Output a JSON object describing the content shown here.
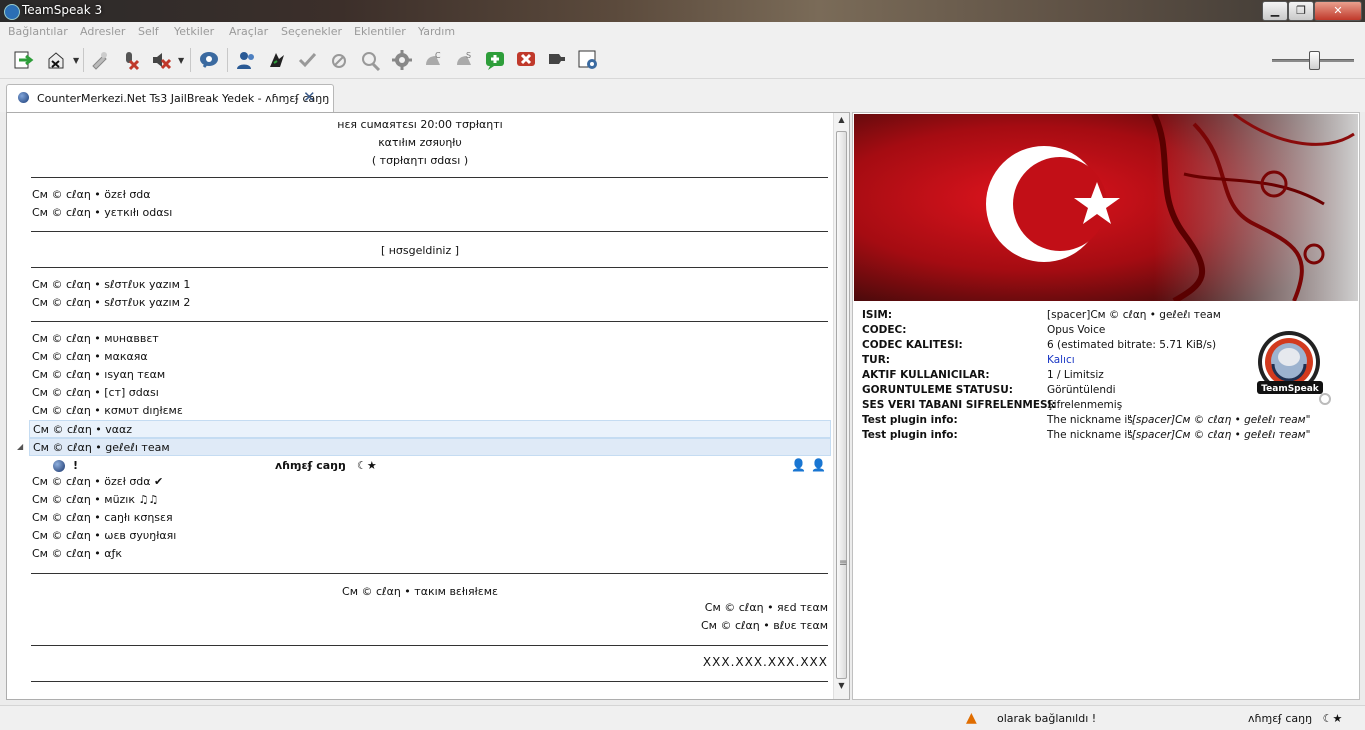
{
  "window": {
    "title": "TeamSpeak 3",
    "min": "▁",
    "max": "❐",
    "close": "✕"
  },
  "menu": [
    "Bağlantılar",
    "Adresler",
    "Self",
    "Yetkiler",
    "Araçlar",
    "Seçenekler",
    "Eklentiler",
    "Yardım"
  ],
  "toolbar": {
    "icons": [
      "connect-icon",
      "disconnect-icon",
      "away-icon",
      "mute-microphone-icon",
      "mute-speakers-icon",
      "whisper-icon",
      "contacts-icon",
      "bookmarks-icon",
      "subscribe-icon",
      "unsubscribe-icon",
      "hotkey-icon",
      "settings-icon",
      "channel-commander-icon",
      "server-query-icon",
      "add-icon",
      "remove-icon",
      "tools-icon",
      "identity-icon"
    ],
    "colors": {
      "accent": "#2b6fb5",
      "danger": "#c0392b",
      "success": "#2e9e3a"
    }
  },
  "tab": {
    "label": "CounterMerkezi.Net Ts3 JailBreak Yedek - ʌɦɱɛʄ caŋŋ",
    "close": "✕"
  },
  "tree": {
    "announce": [
      "нεя cuмαятεsı 20:00 тσpłαηтı",
      "κατıłıм zσяυηłυ",
      "( тσpłαηтı σdαsı )"
    ],
    "group1": [
      "Cм © cℓαη • özεł σdα",
      "Cм © cℓαη • yεткıłı odαsı"
    ],
    "welcome": "[ нσsgeldiniz ]",
    "group2": [
      "Cм © cℓαη • sℓσтℓυк yαzıм 1",
      "Cм © cℓαη • sℓσтℓυк yαzıм 2"
    ],
    "group3": [
      "Cм © cℓαη • мυнαввεт",
      "Cм © cℓαη • мαкαяα",
      "Cм © cℓαη • ısyαη тεαм",
      "Cм © cℓαη • [cт] σdαsı",
      "Cм © cℓαη • кσмυт dıŋłεмε",
      "Cм © cℓαη • vααz",
      "Cм © cℓαη • geℓeℓı тeaм"
    ],
    "client": {
      "prefix": "!",
      "name": "ʌɦɱɛʄ caŋŋ",
      "badge": "☾★"
    },
    "group4": [
      "Cм © cℓαη • özεł σdα ✔",
      "Cм © cℓαη • мüzıк ♫♫",
      "Cм © cℓαη • caŋłı кσηsεя",
      "Cм © cℓαη • ωεв σyυŋłαяı",
      "Cм © cℓαη • αƒк"
    ],
    "teams": {
      "header": "Cм © cℓαη • тαкıм вεłıяłεмε",
      "red": "Cм © cℓαη • яεd тεαм",
      "blue": "Cм © cℓαη • вℓυε тεαм"
    },
    "ip": "XXX.XXX.XXX.XXX"
  },
  "info": {
    "rows": [
      {
        "k": "ISIM:",
        "v": "[spacer]Cм © cℓαη • geℓeℓı тeaм"
      },
      {
        "k": "CODEC:",
        "v": "Opus Voice"
      },
      {
        "k": "CODEC KALITESI:",
        "v": "6 (estimated bitrate: 5.71 KiB/s)"
      },
      {
        "k": "TUR:",
        "v": "Kalıcı"
      },
      {
        "k": "AKTIF KULLANICILAR:",
        "v": "1 / Limitsiz"
      },
      {
        "k": "GORUNTULEME STATUSU:",
        "v": "Görüntülendi"
      },
      {
        "k": "SES VERI TABANI SIFRELENMESI:",
        "v": "Şifrelenmemiş"
      },
      {
        "k": "Test plugin info:",
        "v": "The nickname is",
        "q": "\"[spacer]Cм © cℓαη • geℓeℓı тeaм\""
      },
      {
        "k": "Test plugin info:",
        "v": "The nickname is",
        "q": "\"[spacer]Cм © cℓαη • geℓeℓı тeaм\""
      }
    ],
    "logo_text": "TeamSpeak"
  },
  "status": {
    "message": "olarak bağlanıldı !",
    "user": "ʌɦɱɛʄ caŋŋ",
    "badge": "☾★"
  }
}
